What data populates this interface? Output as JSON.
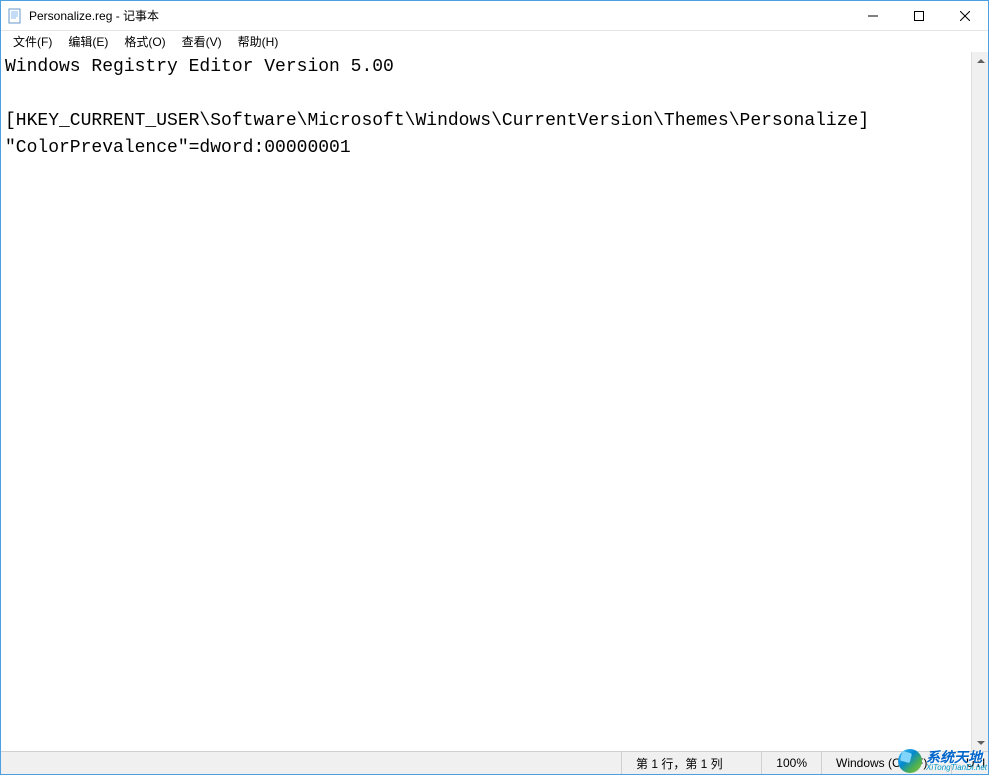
{
  "titlebar": {
    "title": "Personalize.reg - 记事本"
  },
  "menubar": {
    "items": [
      {
        "label": "文件(F)"
      },
      {
        "label": "编辑(E)"
      },
      {
        "label": "格式(O)"
      },
      {
        "label": "查看(V)"
      },
      {
        "label": "帮助(H)"
      }
    ]
  },
  "editor": {
    "content": "Windows Registry Editor Version 5.00\n\n[HKEY_CURRENT_USER\\Software\\Microsoft\\Windows\\CurrentVersion\\Themes\\Personalize]\n\"ColorPrevalence\"=dword:00000001"
  },
  "statusbar": {
    "position": "第 1 行，第 1 列",
    "zoom": "100%",
    "line_ending": "Windows (CRLF)",
    "encoding": "UTI"
  },
  "watermark": {
    "cn": "系统天地",
    "en": "XiTongTianDi.net"
  }
}
